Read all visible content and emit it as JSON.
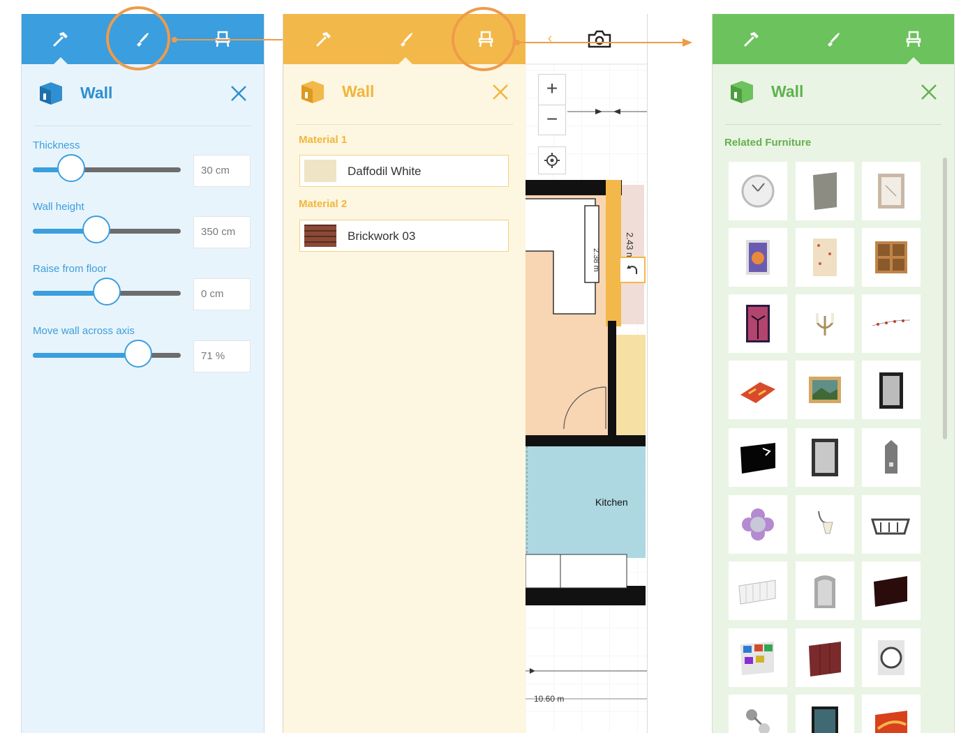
{
  "colors": {
    "build_blue": "#3b9ede",
    "paint_yellow": "#f3b84a",
    "furniture_green": "#6cc25d",
    "highlight_orange": "#ef9b4a"
  },
  "tabs": [
    {
      "name": "build",
      "icon": "hammer-icon"
    },
    {
      "name": "paint",
      "icon": "brush-icon"
    },
    {
      "name": "furniture",
      "icon": "chair-icon"
    }
  ],
  "build_panel": {
    "title": "Wall",
    "sliders": [
      {
        "label": "Thickness",
        "value": "30 cm",
        "position": 0.26
      },
      {
        "label": "Wall height",
        "value": "350 cm",
        "position": 0.43
      },
      {
        "label": "Raise from floor",
        "value": "0 cm",
        "position": 0.5
      },
      {
        "label": "Move wall across axis",
        "value": "71 %",
        "position": 0.71
      }
    ]
  },
  "paint_panel": {
    "title": "Wall",
    "materials": [
      {
        "label": "Material 1",
        "name": "Daffodil White",
        "swatch": "#efe4c4"
      },
      {
        "label": "Material 2",
        "name": "Brickwork 03",
        "swatch": "#7a3f2c"
      }
    ]
  },
  "floor_plan": {
    "dim_vertical_1": "2.43 m",
    "dim_vertical_2": "2.38 m",
    "room_label": "Kitchen",
    "dim_bottom": "10.60 m"
  },
  "furniture_panel": {
    "title": "Wall",
    "section_label": "Related Furniture",
    "items": [
      "wall-clock",
      "grey-panel",
      "framed-sketch",
      "framed-colorful-picture",
      "patterned-wallpaper",
      "wooden-cube-shelf",
      "palm-sunset-picture",
      "wall-candle-sconce",
      "string-lights",
      "red-tile-mosaic",
      "framed-landscape",
      "black-frame-mirror",
      "black-abstract-panel",
      "dark-frame-mirror",
      "wall-cabinet",
      "flower-mirror",
      "wall-lamp",
      "wire-basket-shelf",
      "white-radiator",
      "grey-alcove",
      "dark-brown-panel",
      "photo-collage",
      "maroon-panel",
      "round-wall-clock",
      "chrome-wall-light",
      "framed-painting",
      "red-orange-canvas"
    ]
  }
}
